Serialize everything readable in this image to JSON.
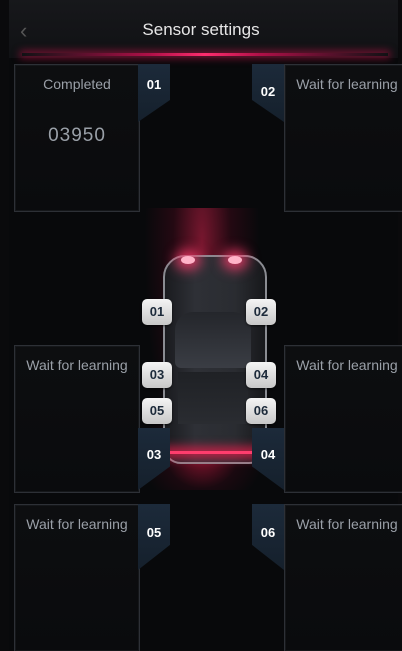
{
  "header": {
    "title": "Sensor settings",
    "back_icon": "chevron-left-icon"
  },
  "panels": [
    {
      "id": "01",
      "status": "Completed",
      "value": "03950"
    },
    {
      "id": "02",
      "status": "Wait for learning"
    },
    {
      "id": "03",
      "status": "Wait for learning"
    },
    {
      "id": "04",
      "status": "Wait for learning"
    },
    {
      "id": "05",
      "status": "Wait for learning"
    },
    {
      "id": "06",
      "status": "Wait for learning"
    }
  ],
  "car_badges": [
    "01",
    "02",
    "03",
    "04",
    "05",
    "06"
  ],
  "colors": {
    "accent": "#ff2d6e",
    "tab_blue": "#1c2a3a",
    "text": "#9aa0a8"
  }
}
